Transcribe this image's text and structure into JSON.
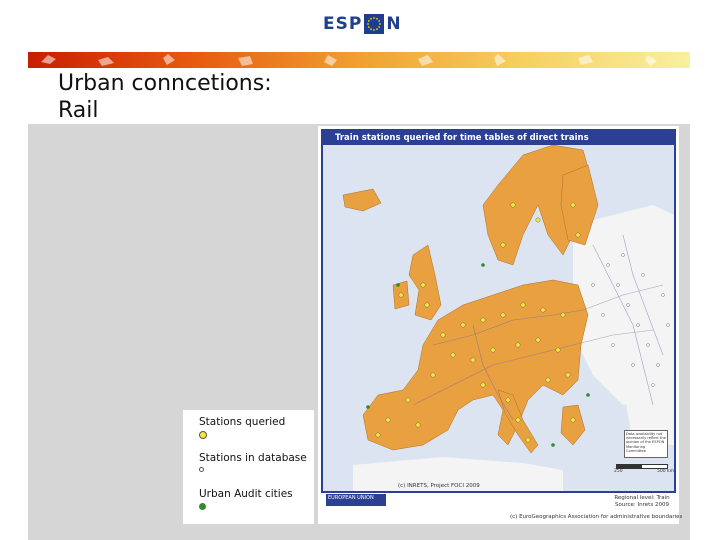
{
  "header": {
    "logo_text_left": "ESP",
    "logo_text_right": "N"
  },
  "slide": {
    "title": "Urban conncetions:\nRail"
  },
  "map": {
    "title": "Train stations queried for time tables of direct trains",
    "credit_source": "(c) INRETS, Project FOCI 2009",
    "credit_boundaries": "(c) EuroGeographics Association for administrative boundaries",
    "regional_level": "Regional level: Train\nSource: Inrets 2009",
    "note_box": "Data availability not necessarily reflect the opinion of the ESPON Monitoring Committee",
    "scale_labels": [
      "250",
      "500 km"
    ],
    "eu_badge": "EUROPEAN UNION",
    "colors": {
      "land": "#e8a040",
      "sea": "#dce4f2",
      "frame": "#2b3f93",
      "non_study_land": "#f4f4f4"
    }
  },
  "legend": {
    "items": [
      {
        "label": "Stations queried",
        "symbol": "yellow-circle",
        "color": "#f5e83a"
      },
      {
        "label": "Stations in database",
        "symbol": "small-white-circle",
        "color": "#ffffff"
      },
      {
        "label": "Urban Audit cities",
        "symbol": "green-circle",
        "color": "#2e8b2e"
      }
    ]
  },
  "palette": {
    "band_left": "#cc2200",
    "band_mid": "#e8a020",
    "band_right": "#f7ec80",
    "slide_bg": "#d6d6d6"
  }
}
